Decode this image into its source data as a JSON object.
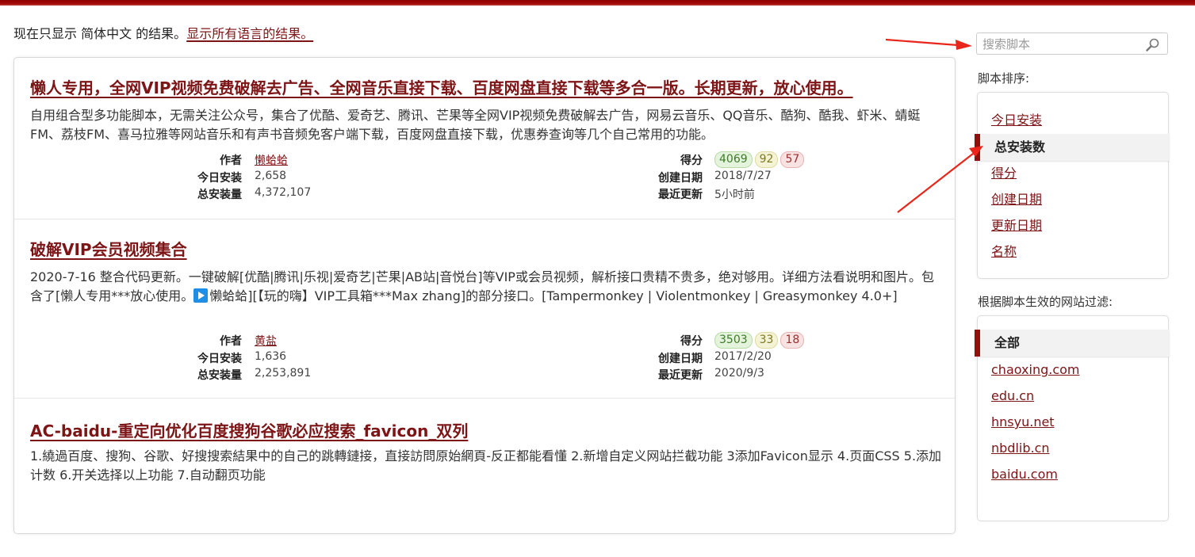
{
  "notice": {
    "prefix": "现在只显示 简体中文 的结果。",
    "link": "显示所有语言的结果。"
  },
  "labels": {
    "author": "作者",
    "daily": "今日安装",
    "total": "总安装量",
    "score": "得分",
    "created": "创建日期",
    "updated": "最近更新"
  },
  "scripts": [
    {
      "title": "懒人专用，全网VIP视频免费破解去广告、全网音乐直接下载、百度网盘直接下载等多合一版。长期更新，放心使用。",
      "description": "自用组合型多功能脚本，无需关注公众号，集合了优酷、爱奇艺、腾讯、芒果等全网VIP视频免费破解去广告，网易云音乐、QQ音乐、酷狗、酷我、虾米、蜻蜓FM、荔枝FM、喜马拉雅等网站音乐和有声书音频免客户端下载，百度网盘直接下载，优惠券查询等几个自己常用的功能。",
      "author": "懒蛤蛤",
      "daily": "2,658",
      "total": "4,372,107",
      "score_good": "4069",
      "score_ok": "92",
      "score_bad": "57",
      "created": "2018/7/27",
      "updated": "5小时前"
    },
    {
      "title": "破解VIP会员视频集合",
      "description_before_icon": "2020-7-16 整合代码更新。一键破解[优酷|腾讯|乐视|爱奇艺|芒果|AB站|音悦台]等VIP或会员视频，解析接口贵精不贵多，绝对够用。详细方法看说明和图片。包含了[懒人专用***放心使用。",
      "description_after_icon": "懒蛤蛤][【玩的嗨】VIP工具箱***Max zhang]的部分接口。[Tampermonkey | Violentmonkey | Greasymonkey 4.0+]",
      "author": "黄盐",
      "daily": "1,636",
      "total": "2,253,891",
      "score_good": "3503",
      "score_ok": "33",
      "score_bad": "18",
      "created": "2017/2/20",
      "updated": "2020/9/3"
    },
    {
      "title": "AC-baidu-重定向优化百度搜狗谷歌必应搜索_favicon_双列",
      "description": "1.繞過百度、搜狗、谷歌、好搜搜索結果中的自己的跳轉鏈接，直接訪問原始網頁-反正都能看懂 2.新增自定义网站拦截功能 3添加Favicon显示 4.页面CSS 5.添加计数 6.开关选择以上功能 7.自动翻页功能"
    }
  ],
  "search": {
    "placeholder": "搜索脚本"
  },
  "sort": {
    "heading": "脚本排序:",
    "items": [
      "今日安装",
      "总安装数",
      "得分",
      "创建日期",
      "更新日期",
      "名称"
    ],
    "active": "总安装数"
  },
  "filter": {
    "heading": "根据脚本生效的网站过滤:",
    "items": [
      "全部",
      "chaoxing.com",
      "edu.cn",
      "hnsyu.net",
      "nbdlib.cn",
      "baidu.com"
    ],
    "active": "全部"
  },
  "colors": {
    "accent": "#7d1416",
    "arrow": "#e8261b",
    "topbar": "#9b0a0a"
  }
}
